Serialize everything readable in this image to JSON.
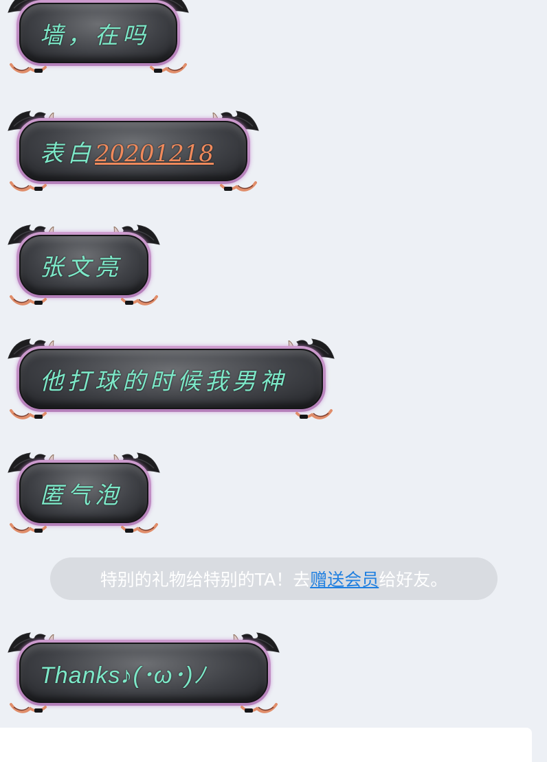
{
  "messages": [
    {
      "text": "墙，在吗"
    },
    {
      "text": "表白",
      "link": "20201218"
    },
    {
      "text": "张文亮"
    },
    {
      "text": "他打球的时候我男神"
    },
    {
      "text": "匿气泡"
    }
  ],
  "notice": {
    "before": "特别的礼物给特别的TA！去",
    "link": "赠送会员",
    "after": "给好友。"
  },
  "last_message": {
    "text": "Thanks♪(･ω･)ﾉ"
  },
  "colors": {
    "background": "#edf0f5",
    "bubble_text": "#7de8c8",
    "bubble_link": "#f08a5c",
    "notice_bg": "#d9dce1",
    "notice_link": "#1f7fe0"
  }
}
